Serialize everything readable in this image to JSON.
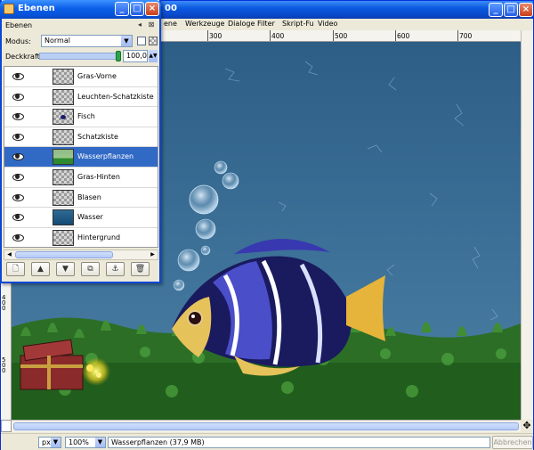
{
  "image_window": {
    "title_fragment": "00",
    "menu": [
      "ene",
      "Werkzeuge",
      "Dialoge",
      "Filter",
      "Skript-Fu",
      "Video"
    ],
    "ruler_top_ticks": [
      "300",
      "400",
      "500",
      "600",
      "700"
    ],
    "ruler_left_ticks": [
      "400",
      "500"
    ],
    "status": {
      "unit": "px",
      "zoom": "100%",
      "info": "Wasserpflanzen (37,9 MB)",
      "cancel": "Abbrechen"
    }
  },
  "layers_dialog": {
    "title": "Ebenen",
    "tab_label": "Ebenen",
    "mode_label": "Modus:",
    "mode_value": "Normal",
    "opacity_label": "Deckkraft:",
    "opacity_value": "100,0",
    "opacity_fraction": 1.0,
    "layers": [
      {
        "name": "Gras-Vorne",
        "thumb": "checker",
        "selected": false
      },
      {
        "name": "Leuchten-Schatzkiste",
        "thumb": "checker",
        "selected": false
      },
      {
        "name": "Fisch",
        "thumb": "fish",
        "selected": false
      },
      {
        "name": "Schatzkiste",
        "thumb": "checker",
        "selected": false
      },
      {
        "name": "Wasserpflanzen",
        "thumb": "plants",
        "selected": true
      },
      {
        "name": "Gras-Hinten",
        "thumb": "checker",
        "selected": false
      },
      {
        "name": "Blasen",
        "thumb": "checker",
        "selected": false
      },
      {
        "name": "Wasser",
        "thumb": "water",
        "selected": false
      },
      {
        "name": "Hintergrund",
        "thumb": "checker",
        "selected": false
      }
    ],
    "buttons": [
      {
        "name": "new-layer-button",
        "glyph": "🗋"
      },
      {
        "name": "raise-layer-button",
        "glyph": "▲"
      },
      {
        "name": "lower-layer-button",
        "glyph": "▼"
      },
      {
        "name": "duplicate-layer-button",
        "glyph": "⧉"
      },
      {
        "name": "anchor-layer-button",
        "glyph": "⚓"
      },
      {
        "name": "delete-layer-button",
        "glyph": "🗑"
      }
    ]
  },
  "colors": {
    "titlebar": "#0a5ae0",
    "selection": "#316ac5",
    "water_dark": "#1c4a6e",
    "water_light": "#4a7ea3",
    "grass": "#2e7b28"
  }
}
